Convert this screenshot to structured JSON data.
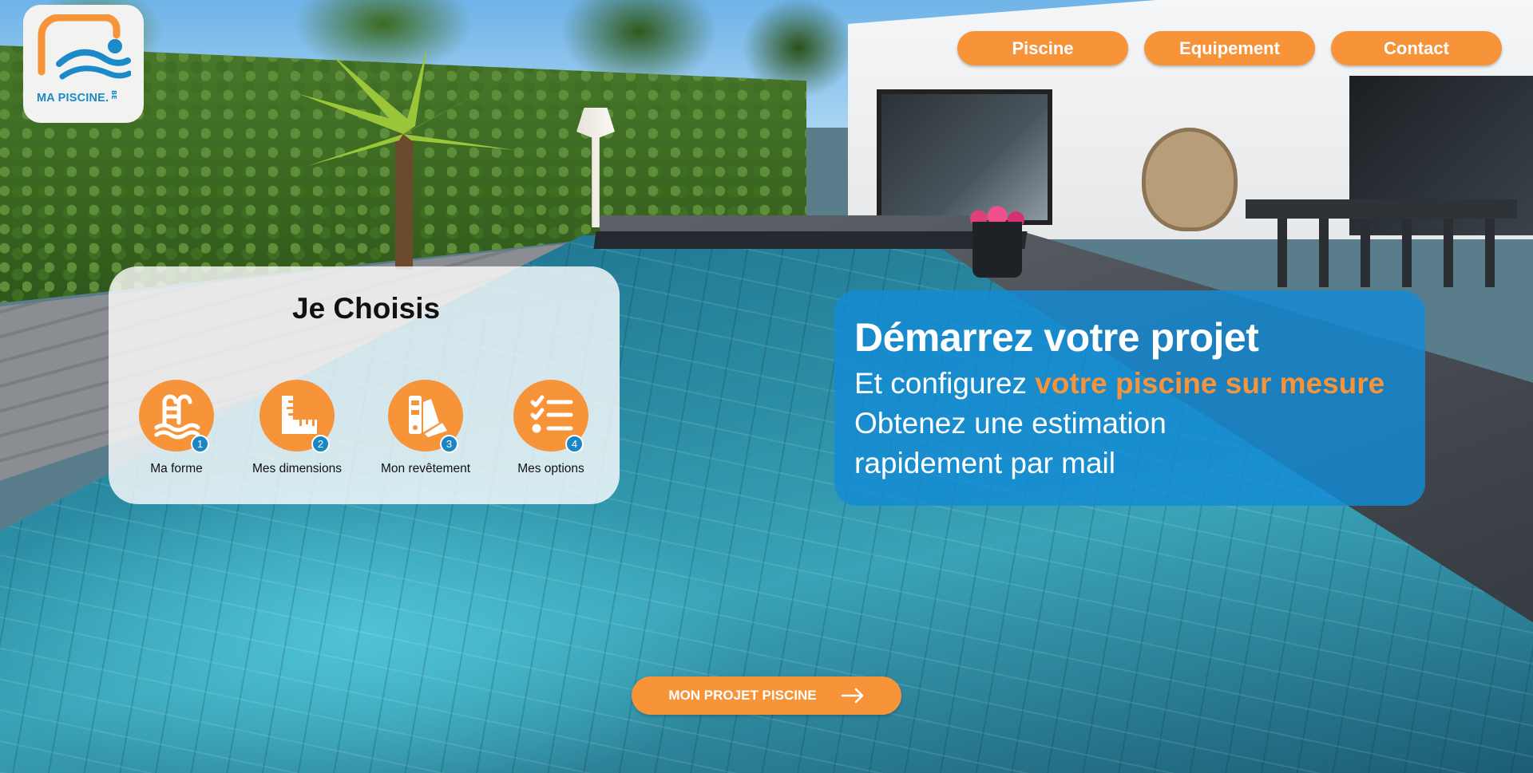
{
  "logo": {
    "text": "MA PISCINE.",
    "suffix": "BE"
  },
  "nav": {
    "items": [
      {
        "label": "Piscine"
      },
      {
        "label": "Equipement"
      },
      {
        "label": "Contact"
      }
    ]
  },
  "choose": {
    "title": "Je Choisis",
    "steps": [
      {
        "number": "1",
        "label": "Ma forme",
        "icon": "pool-ladder-icon"
      },
      {
        "number": "2",
        "label": "Mes dimensions",
        "icon": "ruler-icon"
      },
      {
        "number": "3",
        "label": "Mon revêtement",
        "icon": "color-swatch-icon"
      },
      {
        "number": "4",
        "label": "Mes options",
        "icon": "checklist-icon"
      }
    ]
  },
  "hero": {
    "title": "Démarrez votre projet",
    "line1_prefix": "Et configurez ",
    "line1_accent": "votre piscine sur mesure",
    "line2": "Obtenez une estimation",
    "line3": "rapidement par mail"
  },
  "cta": {
    "label": "MON PROJET PISCINE",
    "icon": "arrow-right-icon"
  },
  "colors": {
    "accent": "#f7943a",
    "brand_blue": "#1a86c6",
    "hero_bg": "#138bd6"
  }
}
